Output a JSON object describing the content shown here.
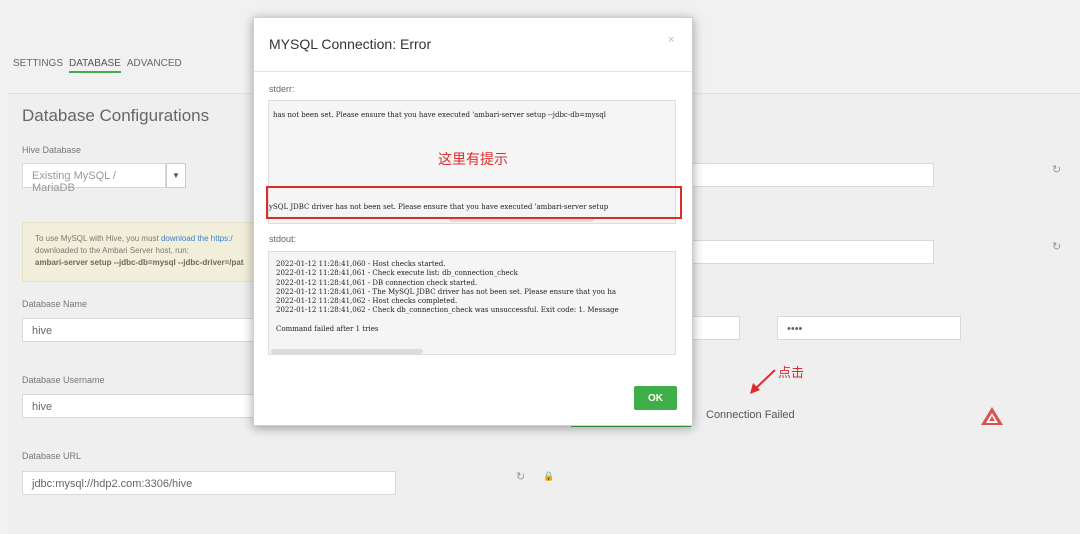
{
  "tabs": [
    {
      "label": "SETTINGS"
    },
    {
      "label": "DATABASE"
    },
    {
      "label": "ADVANCED"
    }
  ],
  "section": {
    "title": "Database Configurations"
  },
  "fields": {
    "hive_database": {
      "label": "Hive Database",
      "value": "Existing MySQL / MariaDB"
    },
    "warning": {
      "line1_prefix": "To use MySQL with Hive, you must ",
      "line1_link": "download the https:/",
      "line2": "downloaded to the Ambari Server host, run:",
      "line3": "ambari-server setup --jdbc-db=mysql --jdbc-driver=/pat"
    },
    "database_name": {
      "label": "Database Name",
      "value": "hive"
    },
    "database_username": {
      "label": "Database Username",
      "value": "hive"
    },
    "database_url": {
      "label": "Database URL",
      "value": "jdbc:mysql://hdp2.com:3306/hive"
    },
    "password_value": "••••"
  },
  "connection": {
    "status": "Connection Failed"
  },
  "annotations": {
    "click": "点击",
    "hint": "这里有提示"
  },
  "icons": {
    "refresh": "refresh-icon",
    "lock": "lock-icon",
    "warning": "warning-triangle-icon",
    "close": "close-icon",
    "dropdown": "caret-down-icon"
  },
  "colors": {
    "accent": "#3fae49",
    "annotation": "#e02b2b",
    "warning": "#d9534f"
  },
  "modal": {
    "title": "MYSQL Connection: Error",
    "close": "×",
    "stderr_label": "stderr:",
    "stderr_line1": "has not been set. Please ensure that you have executed 'ambari-server setup --jdbc-db=mysql",
    "stderr_line2": "ySQL JDBC driver has not been set. Please ensure that you have executed 'ambari-server setup",
    "stdout_label": "stdout:",
    "stdout_lines": [
      "2022-01-12 11:28:41,060 - Host checks started.",
      "2022-01-12 11:28:41,061 - Check execute list: db_connection_check",
      "2022-01-12 11:28:41,061 - DB connection check started.",
      "2022-01-12 11:28:41,061 - The MySQL JDBC driver has not been set. Please ensure that you ha",
      "2022-01-12 11:28:41,062 - Host checks completed.",
      "2022-01-12 11:28:41,062 - Check db_connection_check was unsuccessful. Exit code: 1. Message",
      "",
      "Command failed after 1 tries"
    ],
    "ok_label": "OK"
  }
}
